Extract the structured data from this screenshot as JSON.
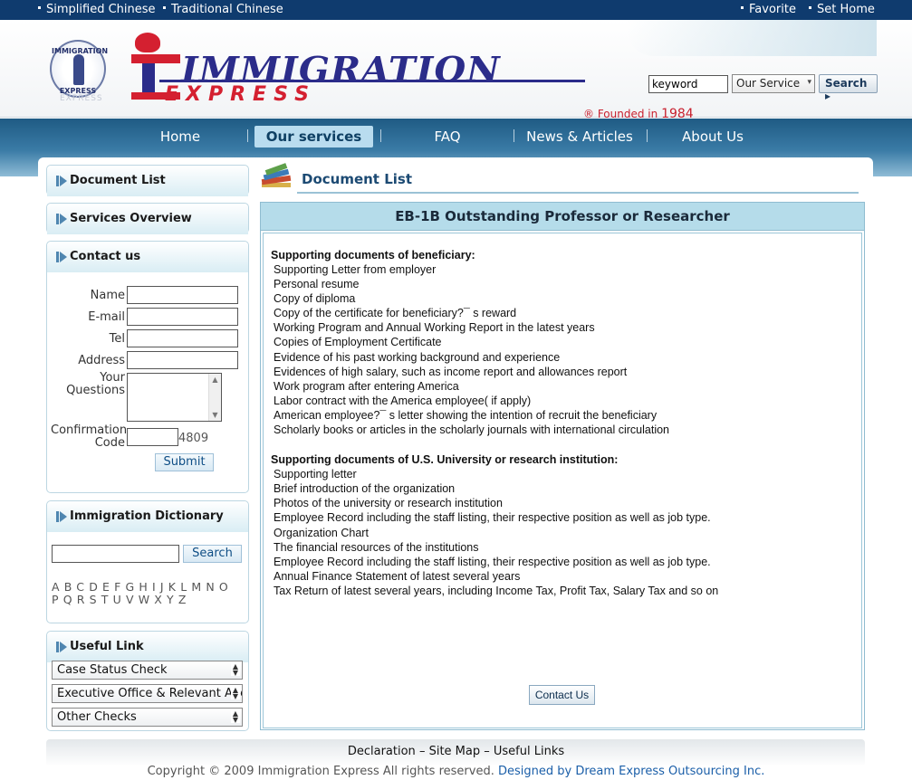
{
  "topbar": {
    "simplified": "Simplified Chinese",
    "traditional": "Traditional Chinese",
    "favorite": "Favorite",
    "set_home": "Set Home"
  },
  "header": {
    "seal_top": "IMMIGRATION",
    "seal_bottom": "EXPRESS",
    "seal_shadow": "EXPRESS",
    "logo_line1": "IMMIGRATION",
    "logo_line2": "EXPRESS",
    "registered": "®",
    "founded_label": "Founded in",
    "founded_year": "1984",
    "keyword_value": "keyword",
    "service_select": "Our Service",
    "search_button": "Search ▸"
  },
  "nav": {
    "items": [
      {
        "label": "Home"
      },
      {
        "label": "Our services"
      },
      {
        "label": "FAQ"
      },
      {
        "label": "News & Articles"
      },
      {
        "label": "About Us"
      }
    ]
  },
  "sidebar": {
    "document_list": "Document List",
    "services_overview": "Services Overview",
    "contact_us": "Contact us",
    "form": {
      "name": "Name",
      "email": "E-mail",
      "tel": "Tel",
      "address": "Address",
      "questions_l1": "Your",
      "questions_l2": "Questions",
      "confirm_l1": "Confirmation",
      "confirm_l2": "Code",
      "code": "4809",
      "submit": "Submit"
    },
    "dictionary": {
      "title": "Immigration Dictionary",
      "search": "Search",
      "letters": "ABCDEFGHIJKLMNOPQRSTUVWXYZ"
    },
    "useful_link": {
      "title": "Useful Link",
      "selects": [
        "Case Status Check",
        "Executive Office & Relevant Agencies",
        "Other Checks"
      ]
    }
  },
  "content": {
    "title": "Document List",
    "doc_title": "EB-1B Outstanding Professor or Researcher",
    "section1": {
      "heading": "Supporting documents of beneficiary:",
      "items": [
        "Supporting Letter from employer",
        "Personal resume",
        "Copy of diploma",
        "Copy of the certificate for beneficiary?¯ s reward",
        "Working Program and Annual Working Report in the latest years",
        "Copies of Employment Certificate",
        "Evidence of his past working background and experience",
        "Evidences of high salary, such as income report and allowances report",
        "Work program after entering America",
        "Labor contract with the America employee( if apply)",
        "American employee?¯ s letter showing the intention of recruit the beneficiary",
        "Scholarly books or articles in the scholarly journals with international circulation"
      ]
    },
    "section2": {
      "heading": "Supporting documents of U.S. University or research institution:",
      "items": [
        "Supporting letter",
        "Brief introduction of the organization",
        "Photos of the university or research institution",
        "Employee Record including the staff listing, their respective position as well as job type.",
        "Organization Chart",
        "The financial resources of the institutions",
        "Employee Record including the staff listing, their respective position as well as job type.",
        "Annual Finance Statement of latest several years",
        "Tax Return of latest several years, including Income Tax, Profit Tax, Salary Tax and so on"
      ]
    },
    "contact_button": "Contact Us"
  },
  "footer": {
    "declaration": "Declaration",
    "site_map": "Site Map",
    "useful_links": "Useful Links",
    "sep": "–",
    "copyright": "Copyright © 2009 Immigration Express All rights reserved.",
    "designed_by": "Designed by Dream Express Outsourcing Inc."
  }
}
